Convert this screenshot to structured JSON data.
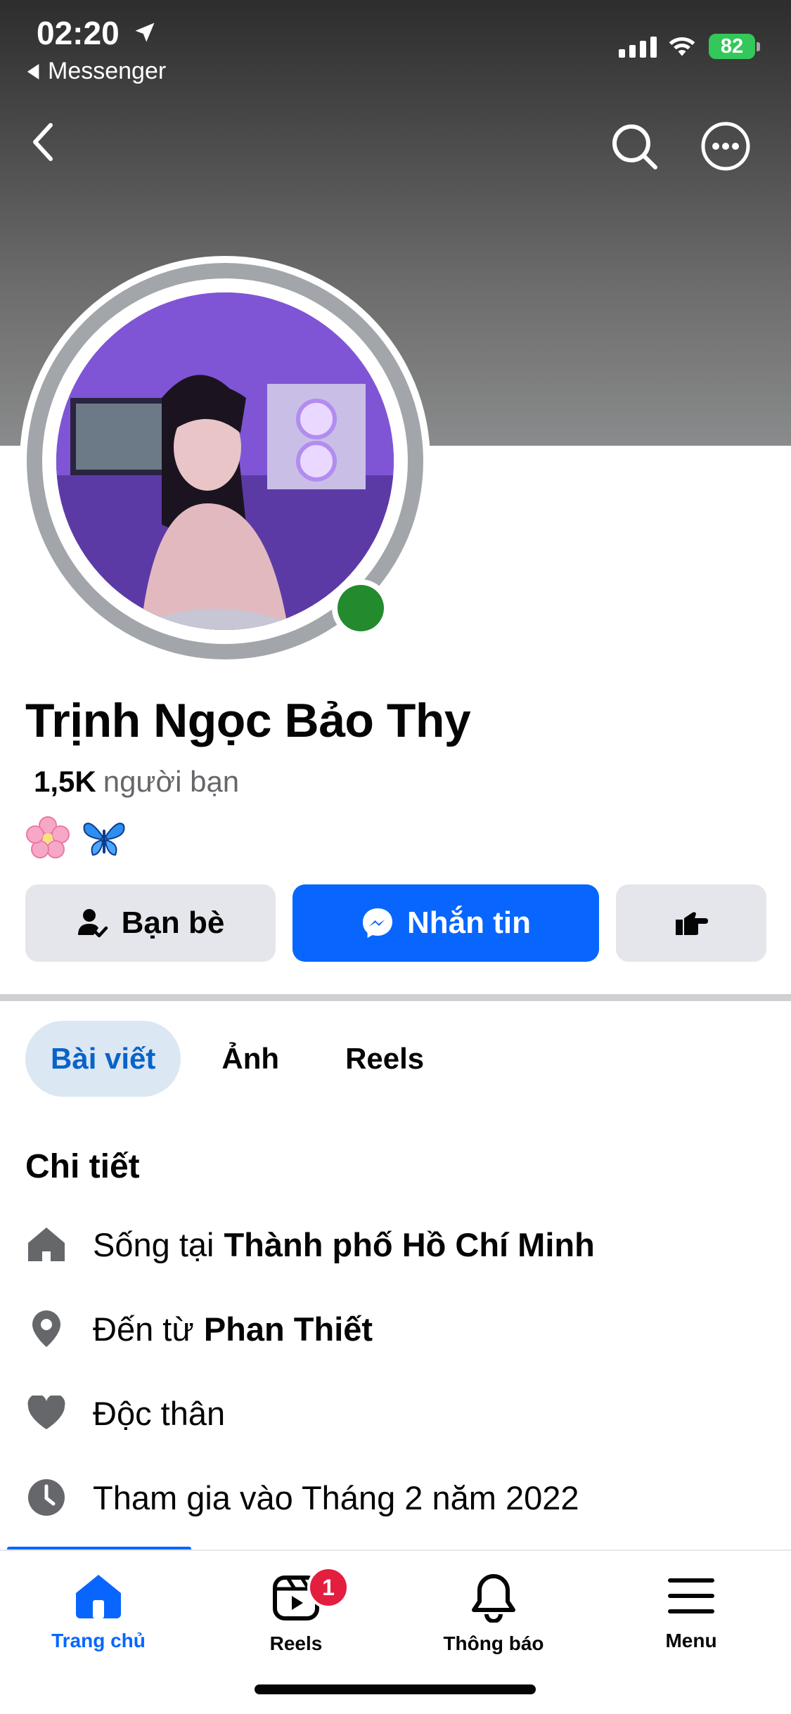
{
  "status_bar": {
    "time": "02:20",
    "back_app": "Messenger",
    "battery": "82"
  },
  "profile": {
    "name": "Trịnh Ngọc Bảo Thy",
    "friend_count": "1,5K",
    "friend_label": "người bạn",
    "emojis": [
      "🌸",
      "🦋"
    ],
    "online": true
  },
  "actions": {
    "friends_label": "Bạn bè",
    "message_label": "Nhắn tin"
  },
  "tabs": [
    {
      "label": "Bài viết",
      "active": true
    },
    {
      "label": "Ảnh",
      "active": false
    },
    {
      "label": "Reels",
      "active": false
    }
  ],
  "details": {
    "title": "Chi tiết",
    "items": [
      {
        "icon": "home-icon",
        "prefix": "Sống tại",
        "value": "Thành phố Hồ Chí Minh"
      },
      {
        "icon": "location-pin-icon",
        "prefix": "Đến từ",
        "value": "Phan Thiết"
      },
      {
        "icon": "heart-icon",
        "prefix": "Độc thân",
        "value": ""
      },
      {
        "icon": "clock-icon",
        "prefix": "Tham gia vào Tháng 2 năm 2022",
        "value": ""
      }
    ]
  },
  "bottom_nav": [
    {
      "label": "Trang chủ",
      "icon": "home-icon",
      "active": true
    },
    {
      "label": "Reels",
      "icon": "reels-icon",
      "badge": "1"
    },
    {
      "label": "Thông báo",
      "icon": "bell-icon"
    },
    {
      "label": "Menu",
      "icon": "menu-icon"
    }
  ],
  "colors": {
    "accent": "#0866ff",
    "online": "#238a2e",
    "badge": "#e41e3f"
  }
}
